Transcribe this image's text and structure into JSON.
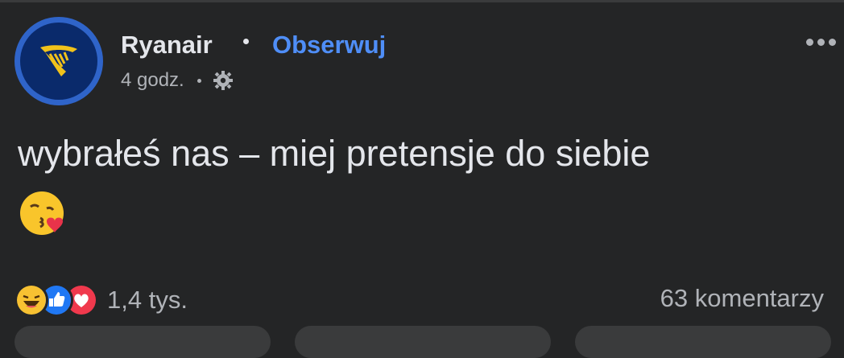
{
  "post": {
    "author": "Ryanair",
    "follow_label": "Obserwuj",
    "time": "4 godz.",
    "privacy_icon": "gear-icon",
    "text": "wybrałeś nas – miej pretensje do siebie",
    "emoji": "kissing-face-with-heart-emoji"
  },
  "footer": {
    "reaction_icons": [
      "laugh-reaction-icon",
      "like-reaction-icon",
      "love-reaction-icon"
    ],
    "reaction_count": "1,4 tys.",
    "comments_count": "63 komentarzy"
  },
  "colors": {
    "background": "#242526",
    "text": "#e4e6eb",
    "secondary_text": "#b0b3b8",
    "link": "#4f8ef7"
  }
}
